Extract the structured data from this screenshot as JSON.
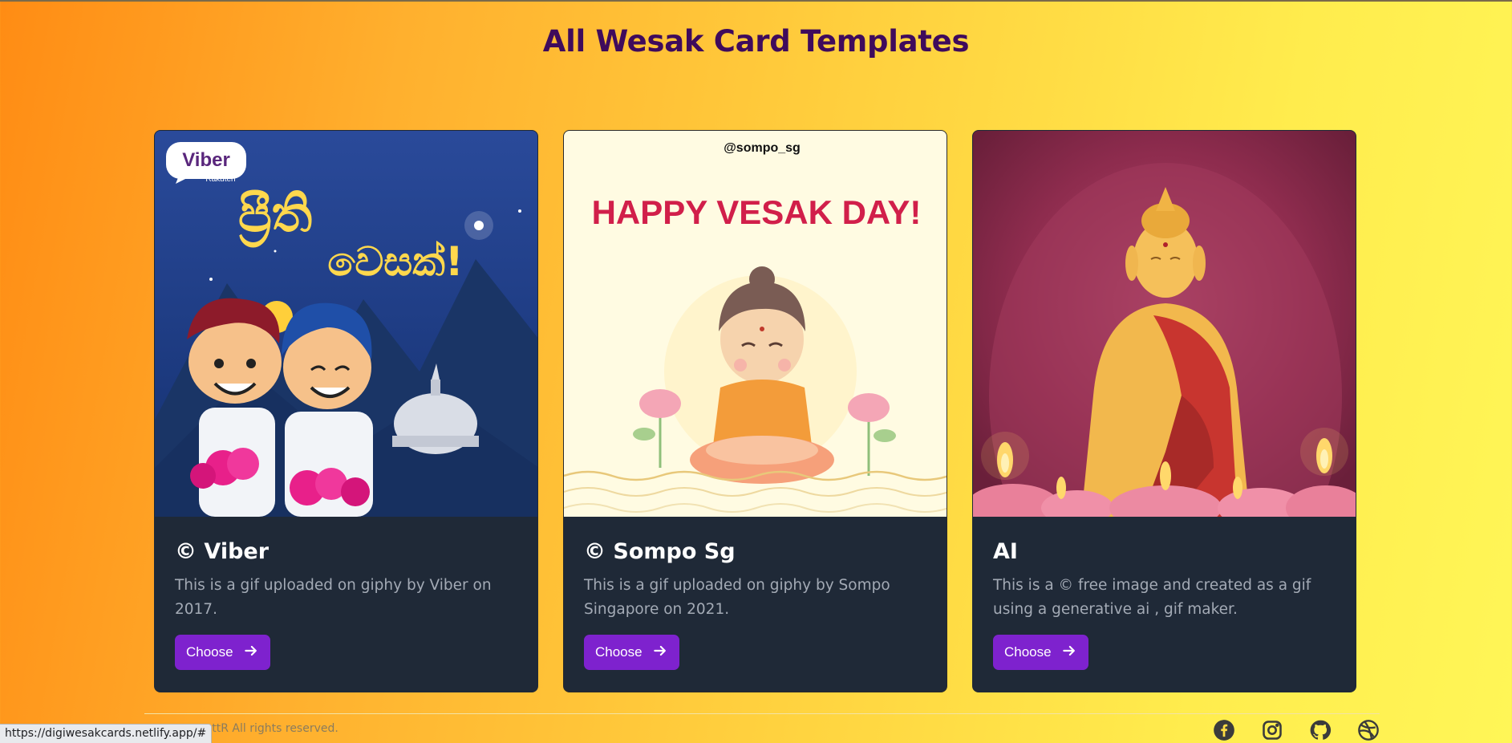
{
  "page": {
    "title": "All Wesak Card Templates"
  },
  "cards": [
    {
      "title": "© Viber",
      "description": "This is a gif uploaded on giphy by Viber on 2017.",
      "button": "Choose",
      "image": {
        "brand_text": "Viber",
        "brand_sub": "Rakuten",
        "headline_1": "ප්‍රීති",
        "headline_2": "වෙසක්!"
      }
    },
    {
      "title": "© Sompo Sg",
      "description": "This is a gif uploaded on giphy by Sompo Singapore on 2021.",
      "button": "Choose",
      "image": {
        "handle": "@sompo_sg",
        "headline": "HAPPY VESAK DAY!"
      }
    },
    {
      "title": "AI",
      "description": "This is a © free image and created as a gif using a generative ai , gif maker.",
      "button": "Choose",
      "image": {}
    }
  ],
  "footer": {
    "copyright": "cottR All rights reserved.",
    "status_url": "https://digiwesakcards.netlify.app/#",
    "social_icons": [
      "facebook-icon",
      "instagram-icon",
      "github-icon",
      "dribbble-icon"
    ]
  },
  "colors": {
    "title": "#3f0b5c",
    "card_bg": "#1f2937",
    "button": "#7e22ce",
    "description": "#a3aab5"
  }
}
